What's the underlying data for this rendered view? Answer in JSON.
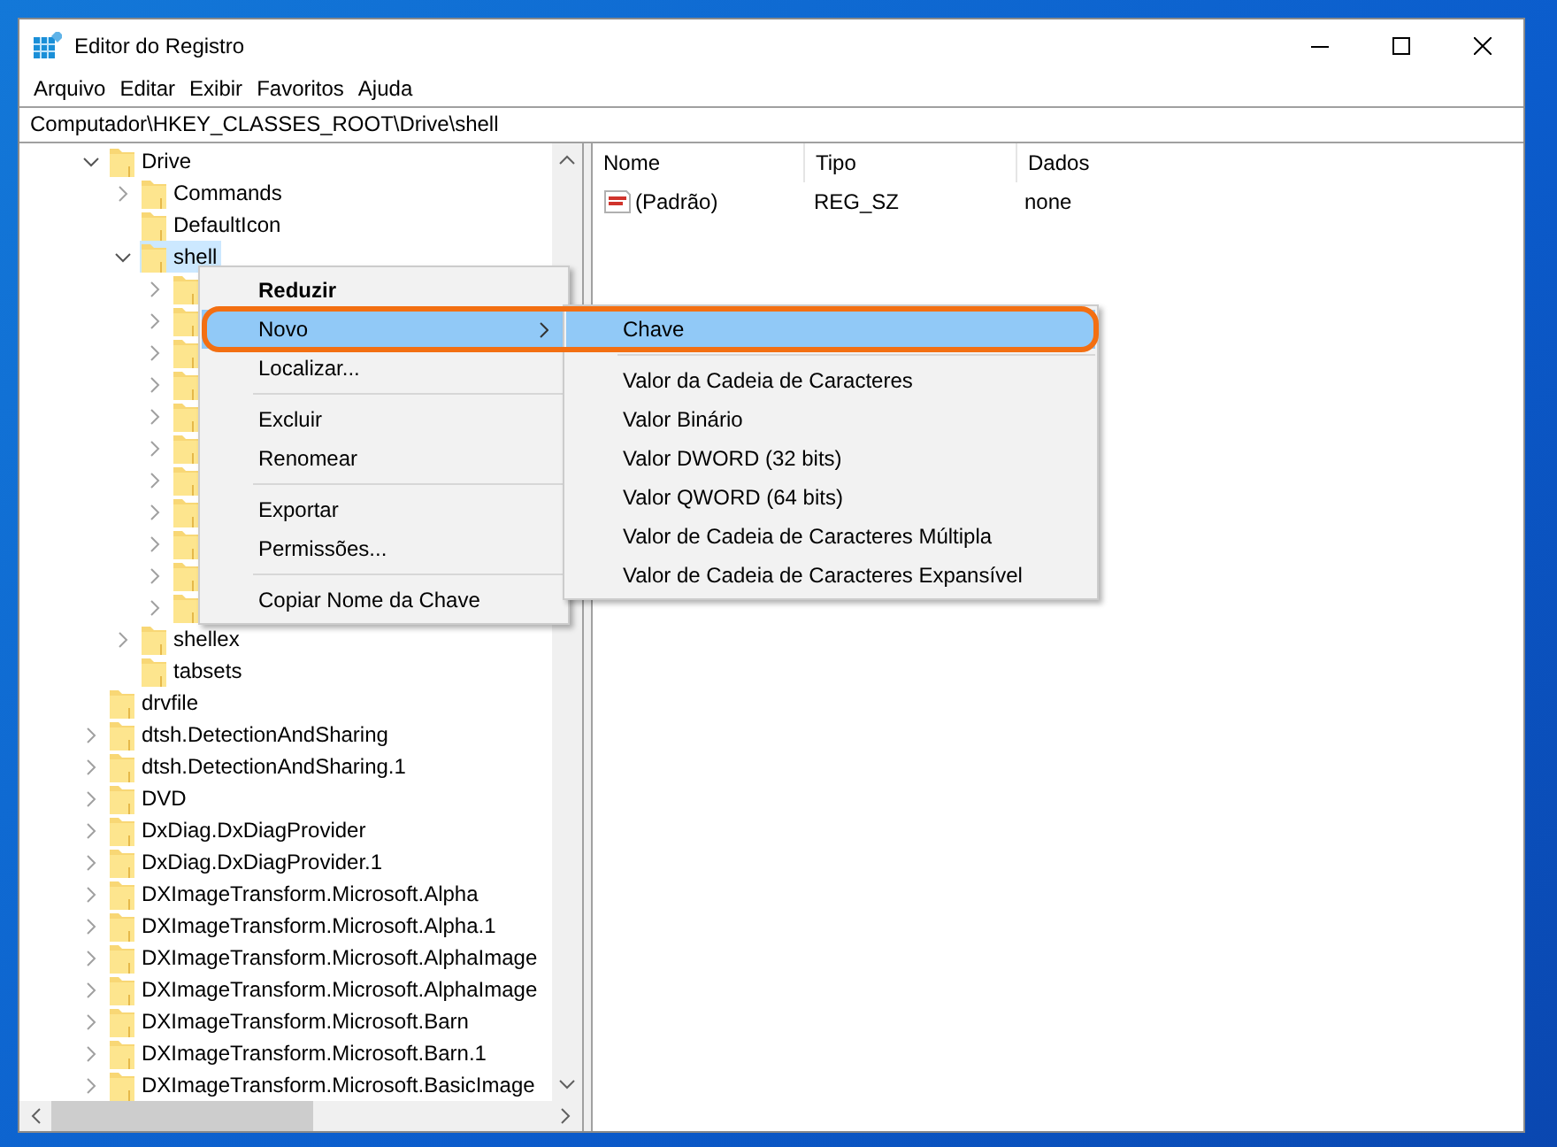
{
  "window": {
    "title": "Editor do Registro"
  },
  "menu_bar": [
    "Arquivo",
    "Editar",
    "Exibir",
    "Favoritos",
    "Ajuda"
  ],
  "address": "Computador\\HKEY_CLASSES_ROOT\\Drive\\shell",
  "tree": [
    {
      "label": "Drive",
      "expandable": true,
      "expanded": true,
      "selected": false,
      "children": [
        {
          "label": "Commands",
          "expandable": true,
          "expanded": false,
          "selected": false
        },
        {
          "label": "DefaultIcon",
          "expandable": false,
          "selected": false
        },
        {
          "label": "shell",
          "expandable": true,
          "expanded": true,
          "selected": true,
          "children": [
            {
              "expandable": true,
              "expanded": false,
              "selected": false
            },
            {
              "expandable": true,
              "expanded": false,
              "selected": false
            },
            {
              "expandable": true,
              "expanded": false,
              "selected": false
            },
            {
              "expandable": true,
              "expanded": false,
              "selected": false
            },
            {
              "expandable": true,
              "expanded": false,
              "selected": false
            },
            {
              "expandable": true,
              "expanded": false,
              "selected": false
            },
            {
              "expandable": true,
              "expanded": false,
              "selected": false
            },
            {
              "expandable": true,
              "expanded": false,
              "selected": false
            },
            {
              "expandable": true,
              "expanded": false,
              "selected": false
            },
            {
              "expandable": true,
              "expanded": false,
              "selected": false
            },
            {
              "expandable": true,
              "expanded": false,
              "selected": false
            }
          ]
        },
        {
          "label": "shellex",
          "expandable": true,
          "expanded": false,
          "selected": false
        },
        {
          "label": "tabsets",
          "expandable": false,
          "selected": false
        }
      ]
    },
    {
      "label": "drvfile",
      "expandable": false,
      "selected": false
    },
    {
      "label": "dtsh.DetectionAndSharing",
      "expandable": true,
      "expanded": false,
      "selected": false
    },
    {
      "label": "dtsh.DetectionAndSharing.1",
      "expandable": true,
      "expanded": false,
      "selected": false
    },
    {
      "label": "DVD",
      "expandable": true,
      "expanded": false,
      "selected": false
    },
    {
      "label": "DxDiag.DxDiagProvider",
      "expandable": true,
      "expanded": false,
      "selected": false
    },
    {
      "label": "DxDiag.DxDiagProvider.1",
      "expandable": true,
      "expanded": false,
      "selected": false
    },
    {
      "label": "DXImageTransform.Microsoft.Alpha",
      "expandable": true,
      "expanded": false,
      "selected": false
    },
    {
      "label": "DXImageTransform.Microsoft.Alpha.1",
      "expandable": true,
      "expanded": false,
      "selected": false
    },
    {
      "label": "DXImageTransform.Microsoft.AlphaImage",
      "expandable": true,
      "expanded": false,
      "selected": false
    },
    {
      "label": "DXImageTransform.Microsoft.AlphaImage",
      "expandable": true,
      "expanded": false,
      "selected": false
    },
    {
      "label": "DXImageTransform.Microsoft.Barn",
      "expandable": true,
      "expanded": false,
      "selected": false
    },
    {
      "label": "DXImageTransform.Microsoft.Barn.1",
      "expandable": true,
      "expanded": false,
      "selected": false
    },
    {
      "label": "DXImageTransform.Microsoft.BasicImage",
      "expandable": true,
      "expanded": false,
      "selected": false
    }
  ],
  "values": {
    "columns": [
      "Nome",
      "Tipo",
      "Dados"
    ],
    "rows": [
      {
        "name": "(Padrão)",
        "type": "REG_SZ",
        "data": "none"
      }
    ]
  },
  "context_menu": {
    "items": [
      {
        "label": "Reduzir",
        "kind": "default",
        "selected": false
      },
      {
        "label": "Novo",
        "kind": "submenu",
        "selected": true
      },
      {
        "label": "Localizar...",
        "kind": "item",
        "selected": false
      },
      {
        "kind": "separator"
      },
      {
        "label": "Excluir",
        "kind": "item",
        "selected": false
      },
      {
        "label": "Renomear",
        "kind": "item",
        "selected": false
      },
      {
        "kind": "separator"
      },
      {
        "label": "Exportar",
        "kind": "item",
        "selected": false
      },
      {
        "label": "Permissões...",
        "kind": "item",
        "selected": false
      },
      {
        "kind": "separator"
      },
      {
        "label": "Copiar Nome da Chave",
        "kind": "item",
        "selected": false
      }
    ]
  },
  "submenu": {
    "items": [
      {
        "label": "Chave",
        "kind": "item",
        "selected": true
      },
      {
        "kind": "separator"
      },
      {
        "label": "Valor da Cadeia de Caracteres",
        "kind": "item",
        "selected": false
      },
      {
        "label": "Valor Binário",
        "kind": "item",
        "selected": false
      },
      {
        "label": "Valor DWORD (32 bits)",
        "kind": "item",
        "selected": false
      },
      {
        "label": "Valor QWORD (64 bits)",
        "kind": "item",
        "selected": false
      },
      {
        "label": "Valor de Cadeia de Caracteres Múltipla",
        "kind": "item",
        "selected": false
      },
      {
        "label": "Valor de Cadeia de Caracteres Expansível",
        "kind": "item",
        "selected": false
      }
    ]
  },
  "highlight_outline": true
}
